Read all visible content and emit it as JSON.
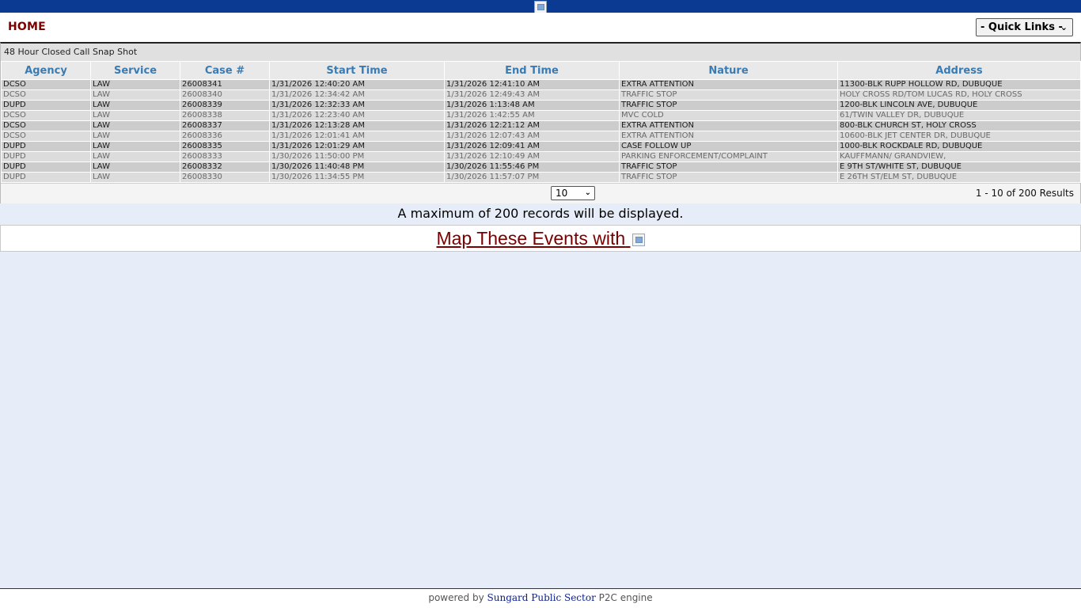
{
  "header": {
    "home_label": "HOME",
    "quick_links": "- Quick Links -"
  },
  "grid": {
    "caption": "48 Hour Closed Call Snap Shot",
    "columns": [
      "Agency",
      "Service",
      "Case #",
      "Start Time",
      "End Time",
      "Nature",
      "Address"
    ],
    "rows": [
      [
        "DCSO",
        "LAW",
        "26008341",
        "1/31/2026 12:40:20 AM",
        "1/31/2026 12:41:10 AM",
        "EXTRA ATTENTION",
        "11300-BLK RUPP HOLLOW RD, DUBUQUE"
      ],
      [
        "DCSO",
        "LAW",
        "26008340",
        "1/31/2026 12:34:42 AM",
        "1/31/2026 12:49:43 AM",
        "TRAFFIC STOP",
        "HOLY CROSS RD/TOM LUCAS RD, HOLY CROSS"
      ],
      [
        "DUPD",
        "LAW",
        "26008339",
        "1/31/2026 12:32:33 AM",
        "1/31/2026 1:13:48 AM",
        "TRAFFIC STOP",
        "1200-BLK LINCOLN AVE, DUBUQUE"
      ],
      [
        "DCSO",
        "LAW",
        "26008338",
        "1/31/2026 12:23:40 AM",
        "1/31/2026 1:42:55 AM",
        "MVC COLD",
        "61/TWIN VALLEY DR, DUBUQUE"
      ],
      [
        "DCSO",
        "LAW",
        "26008337",
        "1/31/2026 12:13:28 AM",
        "1/31/2026 12:21:12 AM",
        "EXTRA ATTENTION",
        "800-BLK CHURCH ST, HOLY CROSS"
      ],
      [
        "DCSO",
        "LAW",
        "26008336",
        "1/31/2026 12:01:41 AM",
        "1/31/2026 12:07:43 AM",
        "EXTRA ATTENTION",
        "10600-BLK JET CENTER DR, DUBUQUE"
      ],
      [
        "DUPD",
        "LAW",
        "26008335",
        "1/31/2026 12:01:29 AM",
        "1/31/2026 12:09:41 AM",
        "CASE FOLLOW UP",
        "1000-BLK ROCKDALE RD, DUBUQUE"
      ],
      [
        "DUPD",
        "LAW",
        "26008333",
        "1/30/2026 11:50:00 PM",
        "1/31/2026 12:10:49 AM",
        "PARKING ENFORCEMENT/COMPLAINT",
        "KAUFFMANN/ GRANDVIEW,"
      ],
      [
        "DUPD",
        "LAW",
        "26008332",
        "1/30/2026 11:40:48 PM",
        "1/30/2026 11:55:46 PM",
        "TRAFFIC STOP",
        "E 9TH ST/WHITE ST, DUBUQUE"
      ],
      [
        "DUPD",
        "LAW",
        "26008330",
        "1/30/2026 11:34:55 PM",
        "1/30/2026 11:57:07 PM",
        "TRAFFIC STOP",
        "E 26TH ST/ELM ST, DUBUQUE"
      ]
    ],
    "page_size": "10",
    "results_text": "1 - 10 of 200 Results"
  },
  "notice": "A maximum of 200 records will be displayed.",
  "map_link": "Map These Events with",
  "footer": {
    "prefix": "powered by",
    "vendor": "Sungard Public Sector",
    "suffix": "P2C engine"
  },
  "colors": {
    "top_bar": "#0b3a93",
    "home_link": "#7a0000",
    "column_header": "#3a7bb4",
    "page_background": "#e6edf8"
  }
}
